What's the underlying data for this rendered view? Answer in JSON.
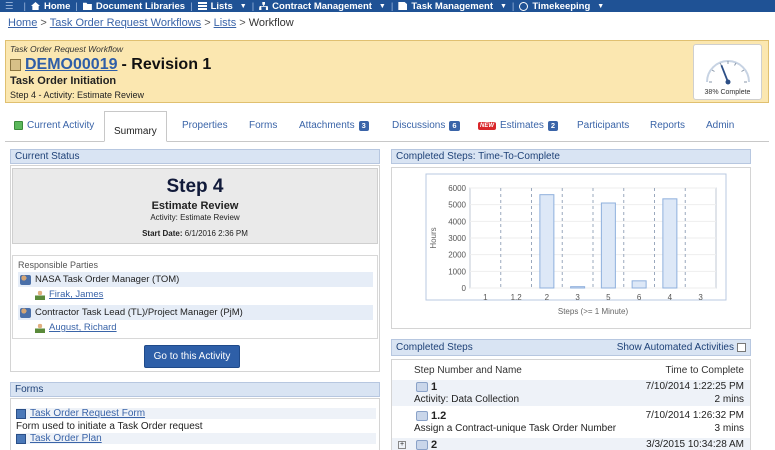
{
  "nav": {
    "items": [
      {
        "label": "Home",
        "icon": "home-icon",
        "dropdown": false
      },
      {
        "label": "Document Libraries",
        "icon": "folder-icon",
        "dropdown": false
      },
      {
        "label": "Lists",
        "icon": "list-icon",
        "dropdown": true
      },
      {
        "label": "Contract Management",
        "icon": "org-chart-icon",
        "dropdown": true
      },
      {
        "label": "Task Management",
        "icon": "document-icon",
        "dropdown": true
      },
      {
        "label": "Timekeeping",
        "icon": "clock-icon",
        "dropdown": true
      }
    ]
  },
  "breadcrumb": {
    "home": "Home",
    "workflows": "Task Order Request Workflows",
    "lists": "Lists",
    "current": "Workflow",
    "sep": ">"
  },
  "header": {
    "workflow_label": "Task Order Request Workflow",
    "doc_id": "DEMO00019",
    "revision": "- Revision 1",
    "stage": "Task Order Initiation",
    "step_line": "Step 4 - Activity: Estimate Review",
    "gauge_label": "38% Complete",
    "progress": 0.38
  },
  "tabs": [
    {
      "label": "Current Activity",
      "badge": null
    },
    {
      "label": "Summary",
      "badge": null,
      "active": true
    },
    {
      "label": "Properties",
      "badge": null
    },
    {
      "label": "Forms",
      "badge": null
    },
    {
      "label": "Attachments",
      "badge": "3"
    },
    {
      "label": "Discussions",
      "badge": "6"
    },
    {
      "label": "Estimates",
      "badge": "2",
      "new_label": "NEW"
    },
    {
      "label": "Participants",
      "badge": null
    },
    {
      "label": "Reports",
      "badge": null
    },
    {
      "label": "Admin",
      "badge": null
    }
  ],
  "current_status": {
    "title": "Current Status",
    "step": "Step 4",
    "name": "Estimate Review",
    "activity": "Activity: Estimate Review",
    "start_label": "Start Date:",
    "start_value": "6/1/2016 2:36 PM",
    "resp_label": "Responsible Parties",
    "parties": [
      {
        "role": "NASA Task Order Manager (TOM)",
        "person": "Firak, James"
      },
      {
        "role": "Contractor Task Lead (TL)/Project Manager (PjM)",
        "person": "August, Richard"
      }
    ],
    "button": "Go to this Activity"
  },
  "forms_panel": {
    "title": "Forms",
    "items": [
      {
        "name": "Task Order Request Form",
        "desc": "Form used to initiate a Task Order request"
      },
      {
        "name": "Task Order Plan",
        "desc": ""
      }
    ]
  },
  "chart_panel": {
    "title": "Completed Steps: Time-To-Complete"
  },
  "chart_data": {
    "type": "bar",
    "categories": [
      "1",
      "1.2",
      "2",
      "3",
      "5",
      "6",
      "4",
      "3"
    ],
    "values": [
      0,
      0,
      5600,
      80,
      5100,
      430,
      5350,
      0
    ],
    "xlabel": "Steps (>= 1 Minute)",
    "ylabel": "Hours",
    "ylim": [
      0,
      6000
    ],
    "yticks": [
      0,
      1000,
      2000,
      3000,
      4000,
      5000,
      6000
    ],
    "bar_color": "#dde8f7",
    "bar_edge": "#8fb0dd"
  },
  "completed_steps": {
    "title": "Completed Steps",
    "show_automated": "Show Automated Activities",
    "col_step": "Step Number and Name",
    "col_time": "Time to Complete",
    "rows": [
      {
        "num": "1",
        "date": "7/10/2014 1:22:25 PM",
        "activity": "Activity: Data Collection",
        "duration": "2 mins"
      },
      {
        "num": "1.2",
        "date": "7/10/2014 1:26:32 PM",
        "activity": "Assign a Contract-unique Task Order Number",
        "duration": "3 mins"
      },
      {
        "num": "2",
        "date": "3/3/2015 10:34:28 AM",
        "activity": "",
        "duration": ""
      }
    ]
  }
}
